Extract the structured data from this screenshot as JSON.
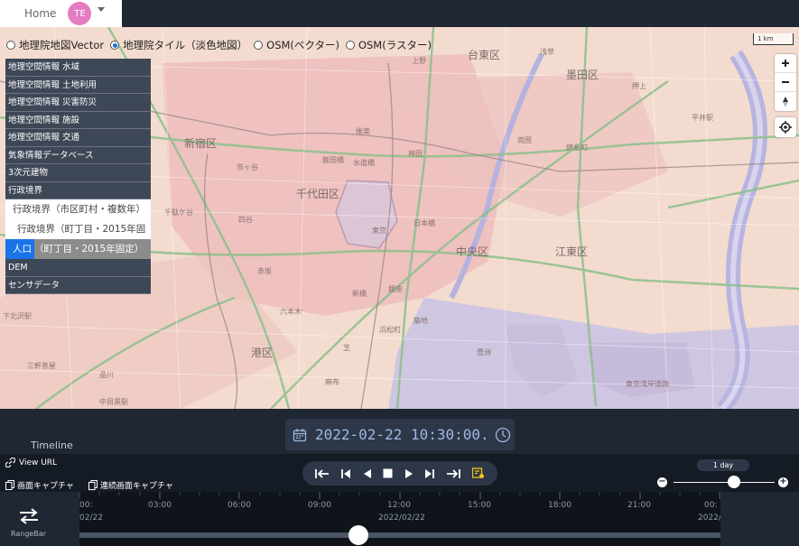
{
  "topbar": {
    "home_label": "Home",
    "avatar_initials": "TE"
  },
  "basemaps": {
    "options": [
      "地理院地図Vector",
      "地理院タイル（淡色地図）",
      "OSM(ベクター)",
      "OSM(ラスター)"
    ],
    "selected_index": 1
  },
  "layers": {
    "items": [
      "地理空間情報 水域",
      "地理空間情報 土地利用",
      "地理空間情報 災害防災",
      "地理空間情報 施設",
      "地理空間情報 交通",
      "気象情報データベース",
      "3次元建物",
      "行政境界"
    ],
    "sub_items": [
      "行政境界（市区町村・複数年）",
      "行政境界（町丁目・2015年固"
    ],
    "active_sub": {
      "highlight": "人口",
      "rest": "（町丁目・2015年固定）"
    },
    "items_after": [
      "DEM",
      "センサデータ"
    ]
  },
  "map": {
    "scale_label": "1 km",
    "wards": [
      "新宿区",
      "千代田区",
      "台東区",
      "墨田区",
      "中央区",
      "江東区",
      "港区"
    ],
    "places": [
      "四谷",
      "飯田橋",
      "後楽",
      "水道橋",
      "上野",
      "浅草",
      "両国",
      "錦糸町",
      "押上",
      "東京",
      "日本橋",
      "銀座",
      "築地",
      "神田",
      "市ヶ谷",
      "赤坂",
      "六本木",
      "麻布",
      "品川",
      "芝",
      "豊洲",
      "東京湾岸道路",
      "新橋",
      "浜松町",
      "千駄ケ谷",
      "平井駅",
      "下北沢駅",
      "中目黒駅",
      "三軒茶屋"
    ]
  },
  "timeline": {
    "label": "Timeline",
    "current_datetime": "2022-02-22 10:30:00.",
    "view_url_label": "View URL",
    "capture_label": "画面キャプチャ",
    "continuous_capture_label": "連続画面キャプチャ",
    "speed_label": "1 day",
    "speed_level": 0.6,
    "rangebar_label": "RangeBar",
    "ticks": [
      "00:",
      "03:00",
      "06:00",
      "09:00",
      "12:00",
      "15:00",
      "18:00",
      "21:00",
      "00:"
    ],
    "date_labels": [
      "02/22",
      "2022/02/22",
      "2022/"
    ],
    "position_fraction": 0.435
  },
  "colors": {
    "accent": "#1a73e8",
    "panel": "#1f2733",
    "layer_bg": "#3e4756"
  }
}
